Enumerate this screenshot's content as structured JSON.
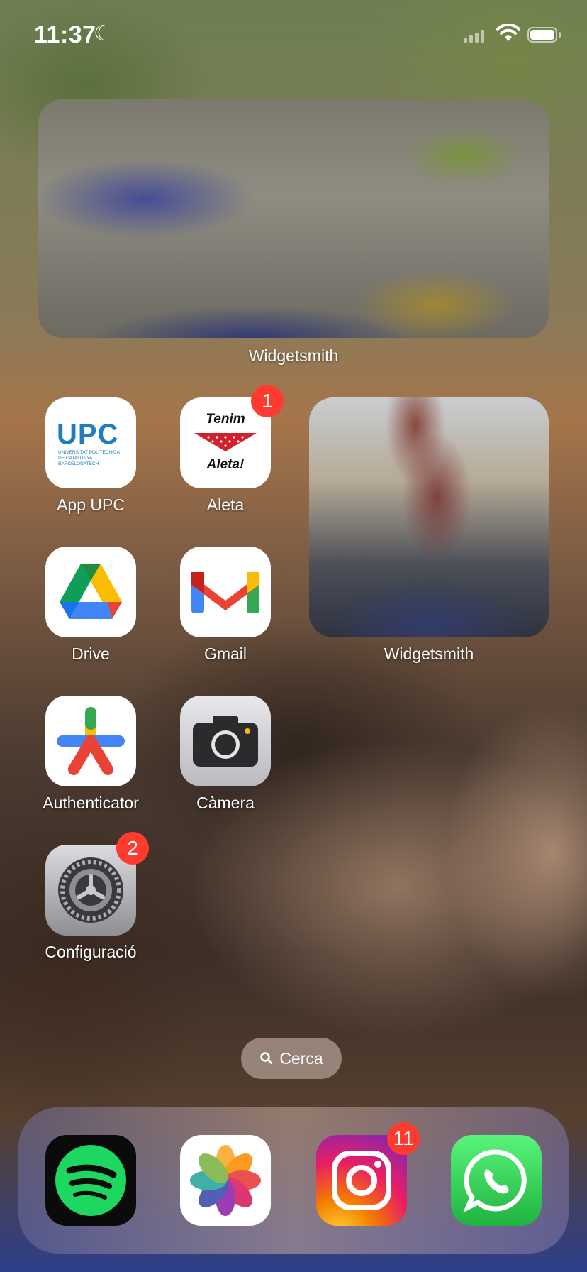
{
  "status_bar": {
    "time": "11:37"
  },
  "widgets": [
    {
      "label": "Widgetsmith"
    },
    {
      "label": "Widgetsmith"
    }
  ],
  "apps": [
    {
      "name": "App UPC",
      "logo": "UPC",
      "logo_sub": "UNIVERSITAT POLITÈCNICA\nDE CATALUNYA\nBARCELONATECH"
    },
    {
      "name": "Aleta",
      "badge": "1",
      "logo_top": "Tenim",
      "logo_bottom": "Aleta!"
    },
    {
      "name": "Drive"
    },
    {
      "name": "Gmail"
    },
    {
      "name": "Authenticator"
    },
    {
      "name": "Càmera"
    },
    {
      "name": "Configuració",
      "badge": "2"
    }
  ],
  "search": {
    "label": "Cerca"
  },
  "dock": [
    {
      "name": "Spotify"
    },
    {
      "name": "Photos"
    },
    {
      "name": "Instagram",
      "badge": "11"
    },
    {
      "name": "WhatsApp"
    }
  ],
  "colors": {
    "badge": "#ff3b30",
    "spotify": "#1ed760",
    "whatsapp": "#25d366"
  }
}
